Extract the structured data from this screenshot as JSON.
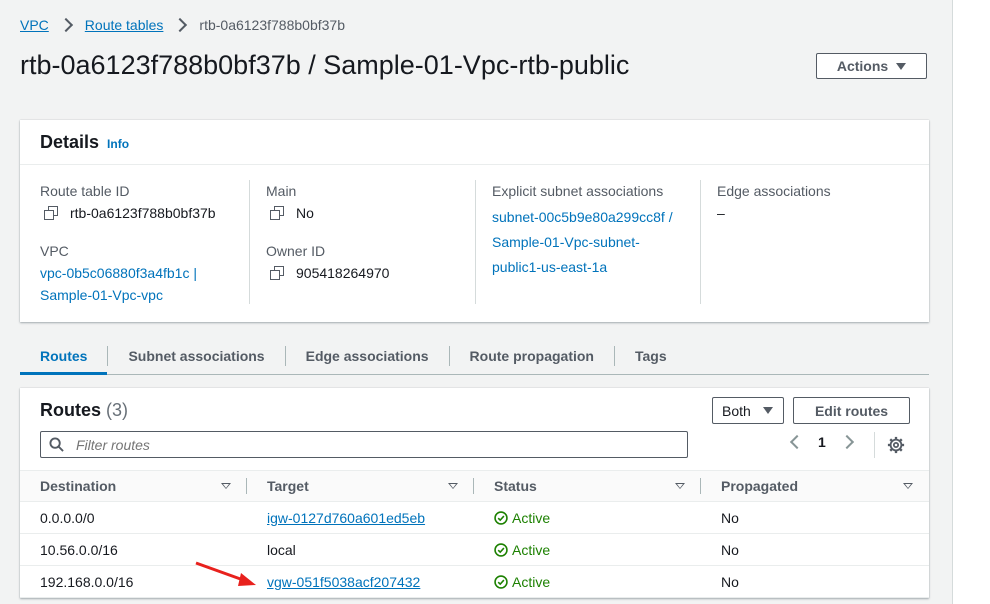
{
  "breadcrumb": [
    {
      "label": "VPC"
    },
    {
      "label": "Route tables"
    },
    {
      "label": "rtb-0a6123f788b0bf37b"
    }
  ],
  "page_title": "rtb-0a6123f788b0bf37b / Sample-01-Vpc-rtb-public",
  "actions_label": "Actions",
  "details": {
    "title": "Details",
    "info": "Info",
    "route_table_id_label": "Route table ID",
    "route_table_id": "rtb-0a6123f788b0bf37b",
    "vpc_label": "VPC",
    "vpc_line1": "vpc-0b5c06880f3a4fb1c |",
    "vpc_line2": "Sample-01-Vpc-vpc",
    "main_label": "Main",
    "main_value": "No",
    "owner_label": "Owner ID",
    "owner_value": "905418264970",
    "explicit_label": "Explicit subnet associations",
    "explicit_line1": "subnet-00c5b9e80a299cc8f /",
    "explicit_line2": "Sample-01-Vpc-subnet-",
    "explicit_line3": "public1-us-east-1a",
    "edge_label": "Edge associations",
    "edge_value": "–"
  },
  "tabs": [
    "Routes",
    "Subnet associations",
    "Edge associations",
    "Route propagation",
    "Tags"
  ],
  "routes": {
    "title": "Routes",
    "count": "(3)",
    "filter_label": "Both",
    "edit_label": "Edit routes",
    "search_placeholder": "Filter routes",
    "page": "1",
    "columns": [
      "Destination",
      "Target",
      "Status",
      "Propagated"
    ],
    "rows": [
      {
        "destination": "0.0.0.0/0",
        "target": "igw-0127d760a601ed5eb",
        "target_link": true,
        "status": "Active",
        "propagated": "No"
      },
      {
        "destination": "10.56.0.0/16",
        "target": "local",
        "target_link": false,
        "status": "Active",
        "propagated": "No"
      },
      {
        "destination": "192.168.0.0/16",
        "target": "vgw-051f5038acf207432",
        "target_link": true,
        "status": "Active",
        "propagated": "No"
      }
    ]
  },
  "colors": {
    "link": "#0073bb",
    "success": "#1d8102",
    "annotation_arrow": "#e8211d"
  }
}
